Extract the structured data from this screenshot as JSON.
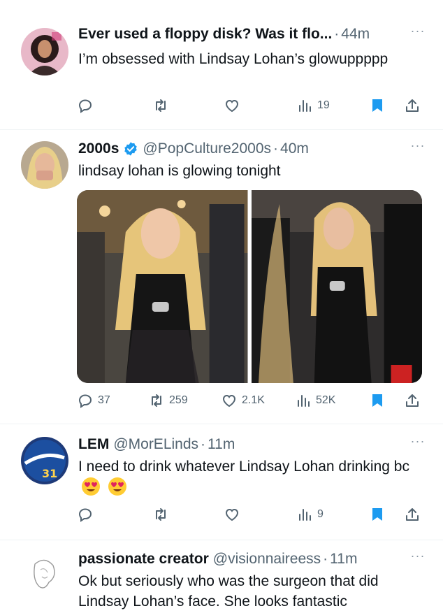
{
  "tweets": [
    {
      "name": "Ever used a floppy disk? Was it flo...",
      "handle": "",
      "time": "44m",
      "text": "I’m obsessed with Lindsay Lohan’s glowuppppp",
      "stats": {
        "replies": "",
        "retweets": "",
        "likes": "",
        "views": "19"
      }
    },
    {
      "name": "2000s",
      "verified": true,
      "handle": "@PopCulture2000s",
      "time": "40m",
      "text": "lindsay lohan is glowing tonight",
      "stats": {
        "replies": "37",
        "retweets": "259",
        "likes": "2.1K",
        "views": "52K"
      }
    },
    {
      "name": "LEM",
      "handle": "@MorELinds",
      "time": "11m",
      "text": "I need to drink whatever Lindsay Lohan drinking bc",
      "emojis": [
        "heart-eyes-emoji",
        "heart-eyes-emoji"
      ],
      "stats": {
        "replies": "",
        "retweets": "",
        "likes": "",
        "views": "9"
      }
    },
    {
      "name": "passionate creator",
      "handle": "@visionnaireess",
      "time": "11m",
      "text": "Ok but seriously who was the surgeon that did Lindsay Lohan’s face. She looks fantastic"
    }
  ],
  "ui": {
    "more_label": "···",
    "separator": "·"
  },
  "colors": {
    "accent": "#1d9bf0",
    "muted": "#536471",
    "text": "#0f1419",
    "divider": "#eff3f4"
  },
  "icons": [
    "reply-icon",
    "retweet-icon",
    "like-icon",
    "views-icon",
    "bookmark-icon",
    "share-icon",
    "verified-icon",
    "more-icon"
  ]
}
